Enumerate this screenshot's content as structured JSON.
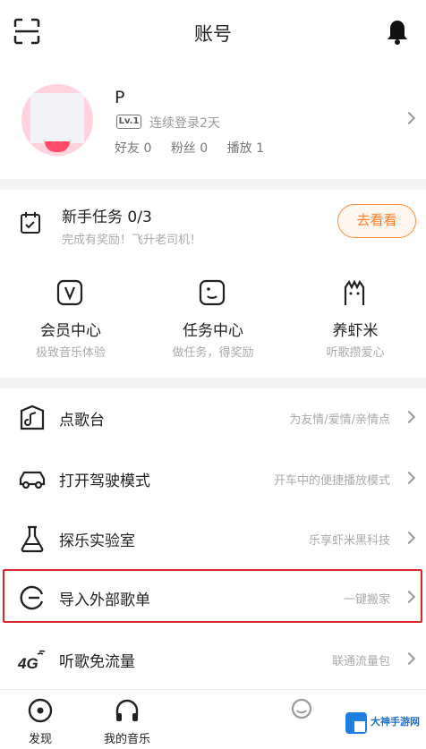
{
  "header": {
    "title": "账号",
    "scan_icon": "scan-icon",
    "bell_icon": "bell-icon"
  },
  "profile": {
    "username": "P",
    "level": "Lv.1",
    "streak": "连续登录2天",
    "stats": {
      "friends": "好友 0",
      "fans": "粉丝 0",
      "plays": "播放 1"
    }
  },
  "task": {
    "title": "新手任务 0/3",
    "subtitle": "完成有奖励！飞升老司机！",
    "button": "去看看"
  },
  "grid": [
    {
      "icon": "vip-icon",
      "label": "会员中心",
      "sub": "极致音乐体验"
    },
    {
      "icon": "task-icon",
      "label": "任务中心",
      "sub": "做任务，得奖励"
    },
    {
      "icon": "shrimp-icon",
      "label": "养虾米",
      "sub": "听歌攒爱心"
    }
  ],
  "rows": [
    {
      "icon": "jukebox-icon",
      "label": "点歌台",
      "sub": "为友情/爱情/亲情点"
    },
    {
      "icon": "car-icon",
      "label": "打开驾驶模式",
      "sub": "开车中的便捷播放模式"
    },
    {
      "icon": "flask-icon",
      "label": "探乐实验室",
      "sub": "乐享虾米黑科技"
    },
    {
      "icon": "import-icon",
      "label": "导入外部歌单",
      "sub": "一键搬家"
    },
    {
      "icon": "4g-icon",
      "label": "听歌免流量",
      "sub": "联通流量包"
    }
  ],
  "tabs": [
    {
      "icon": "discover-icon",
      "label": "发现"
    },
    {
      "icon": "headphones-icon",
      "label": "我的音乐"
    },
    {
      "icon": "account-icon",
      "label": ""
    }
  ],
  "watermark": "大神手游网",
  "colors": {
    "accent": "#ff7a20",
    "highlight": "#d9262d",
    "avatar": "#ff4d6a"
  }
}
